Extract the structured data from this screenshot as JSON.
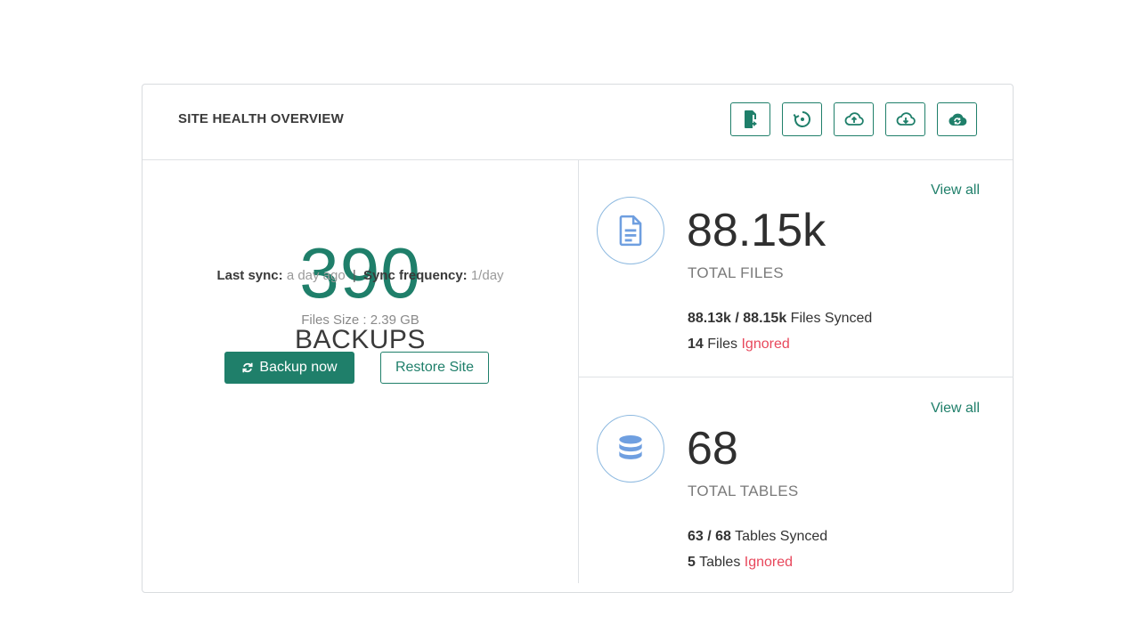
{
  "header": {
    "title": "SITE HEALTH OVERVIEW",
    "toolbar": [
      {
        "icon": "file-export-icon"
      },
      {
        "icon": "restore-icon"
      },
      {
        "icon": "cloud-upload-icon"
      },
      {
        "icon": "cloud-download-icon"
      },
      {
        "icon": "cloud-sync-icon"
      }
    ]
  },
  "backups": {
    "count": "390",
    "label": "BACKUPS",
    "last_sync_label": "Last sync:",
    "last_sync_value": "a day ago",
    "separator": "|",
    "frequency_label": "Sync frequency:",
    "frequency_value": "1/day",
    "files_size": "Files Size : 2.39 GB",
    "backup_button": "Backup now",
    "restore_button": "Restore Site"
  },
  "files": {
    "view_all": "View all",
    "value": "88.15k",
    "label": "TOTAL FILES",
    "synced_count": "88.13k / 88.15k",
    "synced_text": "Files Synced",
    "ignored_count": "14",
    "ignored_unit": "Files",
    "ignored_text": "Ignored",
    "icon": "file-icon"
  },
  "tables": {
    "view_all": "View all",
    "value": "68",
    "label": "TOTAL TABLES",
    "synced_count": "63 / 68",
    "synced_text": "Tables Synced",
    "ignored_count": "5",
    "ignored_unit": "Tables",
    "ignored_text": "Ignored",
    "icon": "database-icon"
  },
  "colors": {
    "accent": "#1f7f6a",
    "ignored": "#e8485c",
    "icon_blue": "#6f9fe0"
  }
}
